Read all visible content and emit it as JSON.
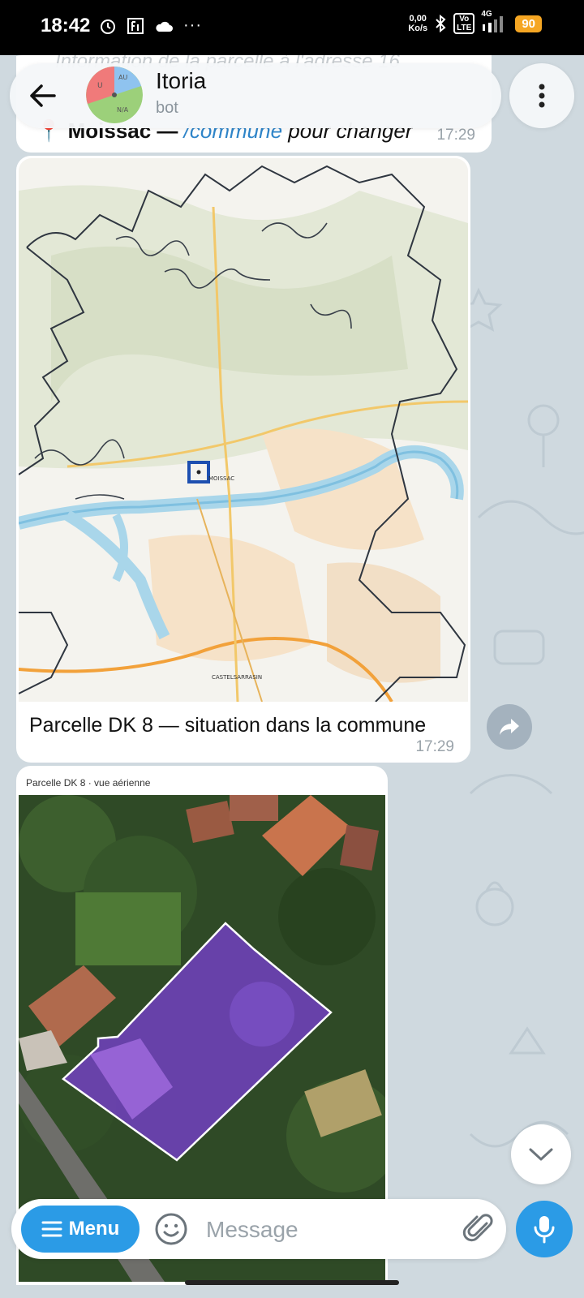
{
  "status_bar": {
    "time": "18:42",
    "net_speed_value": "0,00",
    "net_speed_unit": "Ko/s",
    "volte_top": "Vo",
    "volte_bottom": "LTE",
    "network": "4G",
    "battery": "90",
    "more": "···"
  },
  "header": {
    "title": "Itoria",
    "subtitle": "bot",
    "avatar_labels": [
      "U",
      "AU",
      "N/A"
    ]
  },
  "messages": {
    "previous_text_faded": "Information de la parcelle à l'adresse 16",
    "location_text": "Moissac — ",
    "location_command": "/commune",
    "location_suffix": " pour changer",
    "location_time": "17:29",
    "map_caption": "Parcelle DK 8 — situation dans la commune",
    "map_time": "17:29",
    "aerial_label": "Parcelle DK 8 · vue aérienne",
    "map_place_labels": [
      "MOISSAC",
      "CASTELSARRASIN"
    ]
  },
  "composer": {
    "menu_label": "Menu",
    "placeholder": "Message"
  },
  "colors": {
    "accent": "#2b9be6",
    "chat_bg": "#cfd9df",
    "parcel_overlay": "#7b3fd6"
  }
}
